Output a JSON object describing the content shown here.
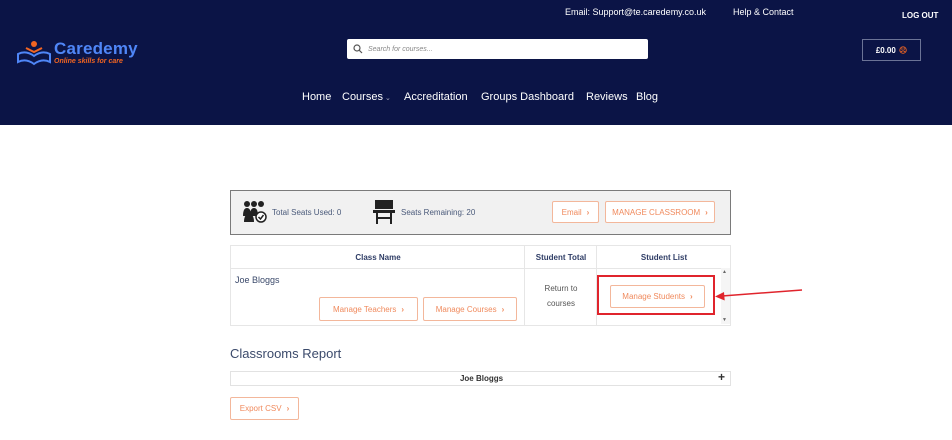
{
  "header": {
    "email_link": "Email: Support@te.caredemy.co.uk",
    "help_link": "Help & Contact",
    "logout": "LOG OUT",
    "logo_name": "Caredemy",
    "logo_tagline": "Online skills for care",
    "search_placeholder": "Search for courses...",
    "cart_total": "£0.00"
  },
  "nav": {
    "items": [
      "Home",
      "Courses",
      "Accreditation",
      "Groups Dashboard",
      "Reviews",
      "Blog"
    ]
  },
  "seats": {
    "used_label": "Total Seats Used: 0",
    "remaining_label": "Seats Remaining: 20",
    "email_button": "Email",
    "manage_classroom_button": "MANAGE CLASSROOM"
  },
  "table": {
    "headers": [
      "Class Name",
      "Student Total",
      "Student List"
    ],
    "row": {
      "class_name": "Joe Bloggs",
      "manage_teachers": "Manage Teachers",
      "manage_courses": "Manage Courses",
      "student_total_line1": "Return to",
      "student_total_line2": "courses",
      "manage_students": "Manage Students"
    }
  },
  "report": {
    "title": "Classrooms Report",
    "accordion_label": "Joe Bloggs",
    "export_button": "Export CSV"
  },
  "colors": {
    "header_bg": "#0b1446",
    "accent_orange": "#f08a5d",
    "highlight_red": "#e0242c",
    "brand_blue": "#4f86f7"
  }
}
